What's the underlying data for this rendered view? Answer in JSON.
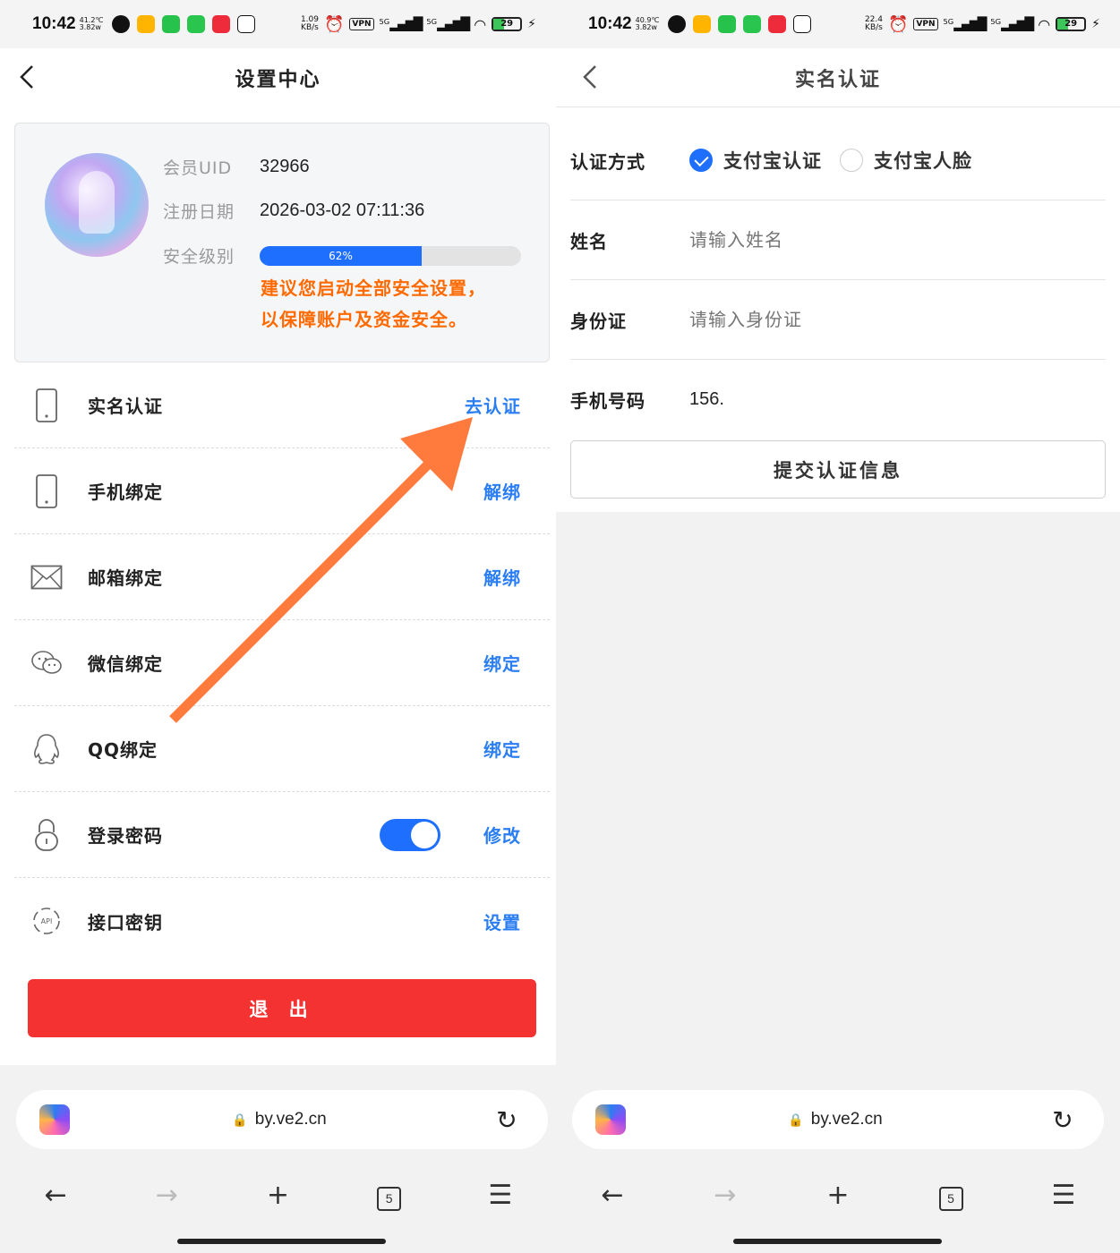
{
  "status_bar": {
    "left_time": "10:42",
    "left_temp": "41.2℃",
    "left_speed_sub": "3.82w",
    "left_net_speed": "1.09",
    "left_net_unit": "KB/s",
    "right_time": "10:42",
    "right_temp": "40.9℃",
    "right_speed_sub": "3.82w",
    "right_net_speed": "22.4",
    "right_net_unit": "KB/s",
    "vpn": "VPN",
    "signal1": "5G",
    "signal2": "5G",
    "battery": "29"
  },
  "settings": {
    "title": "设置中心",
    "profile": {
      "uid_label": "会员UID",
      "uid_value": "32966",
      "reg_label": "注册日期",
      "reg_value": "2026-03-02 07:11:36",
      "security_label": "安全级别",
      "security_percent_text": "62%",
      "security_level": 0.62,
      "warning_line1": "建议您启动全部安全设置，",
      "warning_line2": "以保障账户及资金安全。"
    },
    "menu": [
      {
        "label": "实名认证",
        "action": "去认证",
        "icon": "phone-icon"
      },
      {
        "label": "手机绑定",
        "action": "解绑",
        "icon": "phone-icon"
      },
      {
        "label": "邮箱绑定",
        "action": "解绑",
        "icon": "mail-icon"
      },
      {
        "label": "微信绑定",
        "action": "绑定",
        "icon": "wechat-icon"
      },
      {
        "label": "QQ绑定",
        "action": "绑定",
        "icon": "qq-icon"
      },
      {
        "label": "登录密码",
        "action": "修改",
        "icon": "lock-icon"
      },
      {
        "label": "接口密钥",
        "action": "设置",
        "icon": "api-icon"
      }
    ],
    "logout_label": "退 出",
    "accent_color": "#2b7ef2",
    "warning_color": "#ff6a00",
    "logout_color": "#f53232"
  },
  "verify": {
    "title": "实名认证",
    "method_label": "认证方式",
    "method_option1": "支付宝认证",
    "method_option2": "支付宝人脸",
    "name_label": "姓名",
    "name_placeholder": "请输入姓名",
    "id_label": "身份证",
    "id_placeholder": "请输入身份证",
    "phone_label": "手机号码",
    "phone_value": "156.",
    "submit_label": "提交认证信息"
  },
  "browser": {
    "url": "by.ve2.cn",
    "tabs_count": "5",
    "icons": [
      "back-icon",
      "forward-icon",
      "new-tab-icon",
      "tabs-icon",
      "menu-icon",
      "reload-icon",
      "lock-icon"
    ]
  }
}
